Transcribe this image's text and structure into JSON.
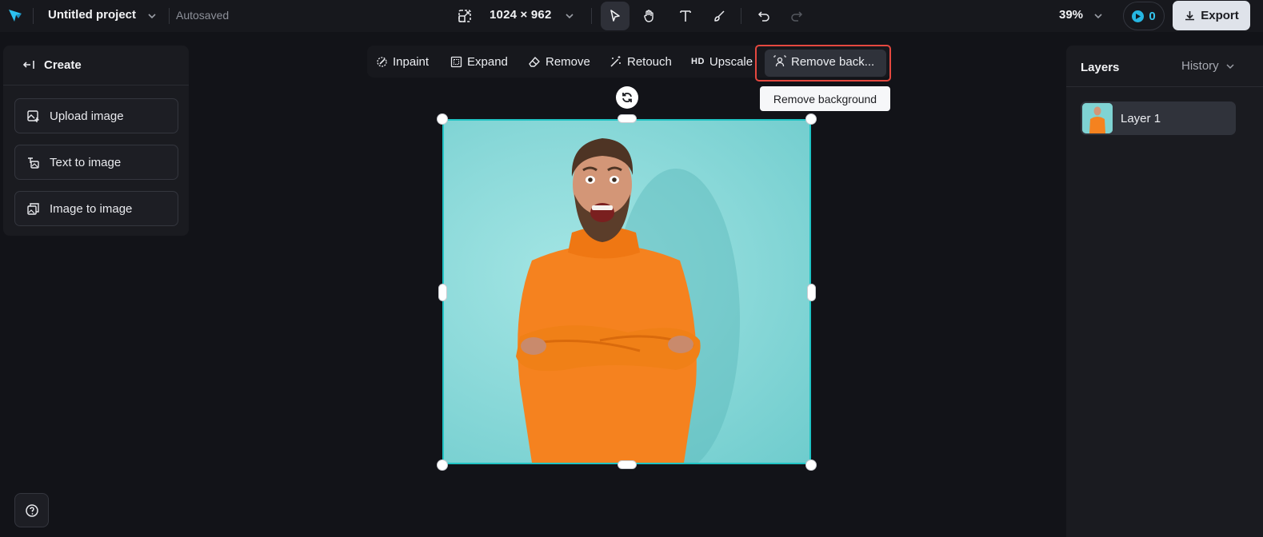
{
  "topbar": {
    "logo_icon": "app-logo-icon",
    "project_title": "Untitled project",
    "autosave_status": "Autosaved",
    "canvas_size": "1024 × 962",
    "zoom": "39%",
    "credits": "0",
    "export_label": "Export",
    "tools": [
      "select-tool-icon",
      "hand-tool-icon",
      "text-tool-icon",
      "brush-tool-icon",
      "undo-icon",
      "redo-icon"
    ]
  },
  "left_panel": {
    "title": "Create",
    "buttons": [
      {
        "label": "Upload image",
        "icon": "upload-image-icon"
      },
      {
        "label": "Text to image",
        "icon": "text-to-image-icon"
      },
      {
        "label": "Image to image",
        "icon": "image-to-image-icon"
      }
    ]
  },
  "edit_toolbar": {
    "items": [
      {
        "label": "Inpaint",
        "icon": "inpaint-icon"
      },
      {
        "label": "Expand",
        "icon": "expand-icon"
      },
      {
        "label": "Remove",
        "icon": "eraser-icon"
      },
      {
        "label": "Retouch",
        "icon": "magic-wand-icon"
      },
      {
        "label": "Upscale",
        "icon": "hd-icon",
        "prefix": "HD"
      },
      {
        "label": "Remove back...",
        "icon": "remove-background-icon"
      }
    ],
    "tooltip": "Remove background"
  },
  "right_panel": {
    "tab_layers": "Layers",
    "tab_history": "History",
    "layers": [
      {
        "name": "Layer 1"
      }
    ]
  },
  "colors": {
    "accent": "#35c6ee",
    "selection": "#20c4c4",
    "highlight": "#e5483f",
    "image_background": "#8ddada",
    "sweater": "#f5821f"
  }
}
